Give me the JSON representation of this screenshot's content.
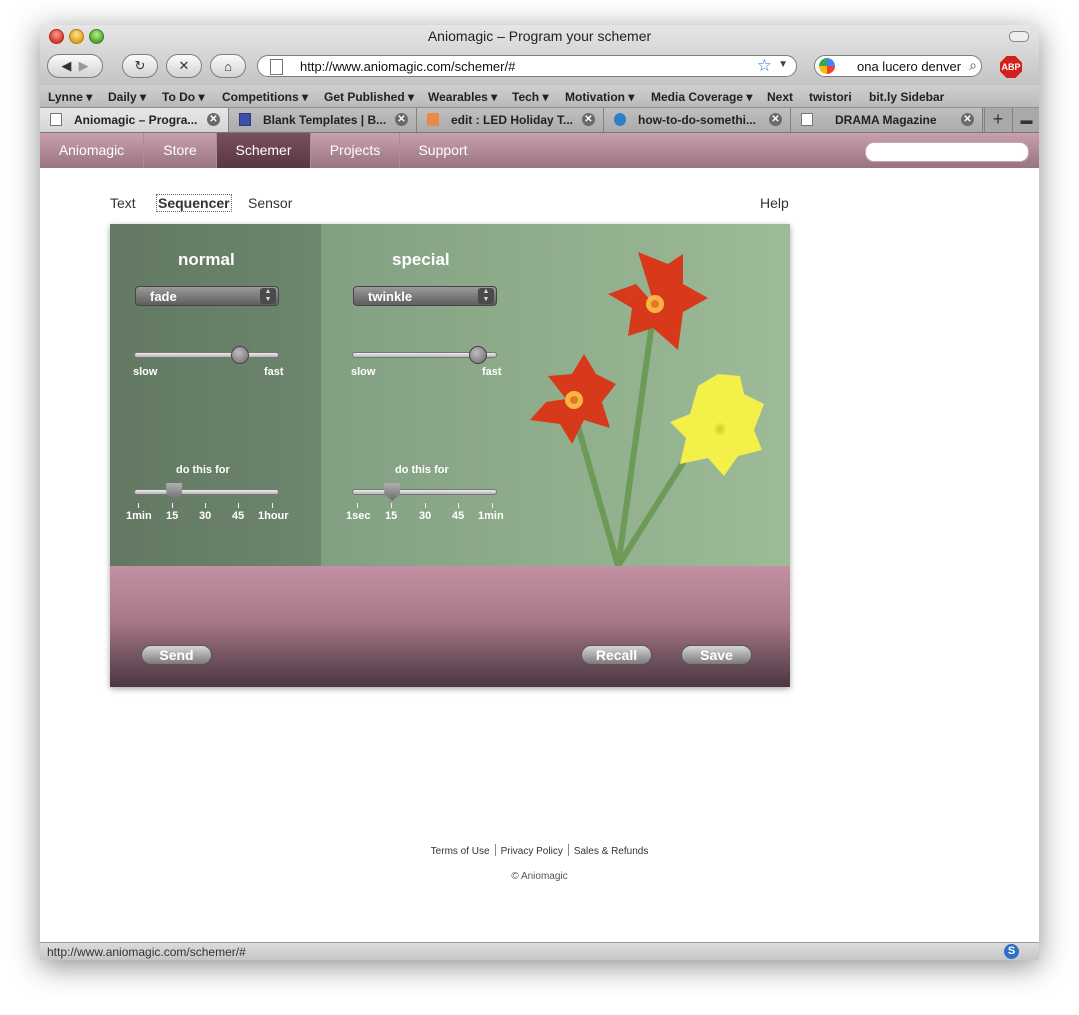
{
  "window": {
    "title": "Aniomagic – Program your schemer"
  },
  "toolbar": {
    "url": "http://www.aniomagic.com/schemer/#",
    "search_value": "ona lucero denver",
    "abp_label": "ABP"
  },
  "bookmarks": [
    {
      "label": "Lynne"
    },
    {
      "label": "Daily"
    },
    {
      "label": "To Do"
    },
    {
      "label": "Competitions"
    },
    {
      "label": "Get Published"
    },
    {
      "label": "Wearables"
    },
    {
      "label": "Tech"
    },
    {
      "label": "Motivation"
    },
    {
      "label": "Media Coverage"
    },
    {
      "label": "Next"
    },
    {
      "label": "twistori"
    },
    {
      "label": "bit.ly Sidebar"
    }
  ],
  "tabs": [
    {
      "label": "Aniomagic – Progra..."
    },
    {
      "label": "Blank Templates | B..."
    },
    {
      "label": "edit : LED Holiday T..."
    },
    {
      "label": "how-to-do-somethi..."
    },
    {
      "label": "DRAMA Magazine"
    }
  ],
  "site_nav": [
    {
      "label": "Aniomagic"
    },
    {
      "label": "Store"
    },
    {
      "label": "Schemer"
    },
    {
      "label": "Projects"
    },
    {
      "label": "Support"
    }
  ],
  "subtabs": {
    "text": "Text",
    "sequencer": "Sequencer",
    "sensor": "Sensor",
    "help": "Help"
  },
  "normal": {
    "title": "normal",
    "mode": "fade",
    "speed_min": "slow",
    "speed_max": "fast",
    "speed_level": 0.76,
    "duration_label": "do this for",
    "duration_level": 0.25,
    "ticks": [
      "1min",
      "15",
      "30",
      "45",
      "1hour"
    ]
  },
  "special": {
    "title": "special",
    "mode": "twinkle",
    "speed_min": "slow",
    "speed_max": "fast",
    "speed_level": 0.92,
    "duration_label": "do this for",
    "duration_level": 0.25,
    "ticks": [
      "1sec",
      "15",
      "30",
      "45",
      "1min"
    ]
  },
  "buttons": {
    "send": "Send",
    "recall": "Recall",
    "save": "Save"
  },
  "footer": {
    "terms": "Terms of Use",
    "privacy": "Privacy Policy",
    "sales": "Sales & Refunds",
    "copyright": "© Aniomagic"
  },
  "status": {
    "text": "http://www.aniomagic.com/schemer/#",
    "icon_letter": "S"
  },
  "colors": {
    "accent_nav": "#a87889",
    "normal_panel": "#677e67",
    "special_panel": "#93b08e",
    "flower_red": "#d8391a",
    "flower_yellow": "#f3f04a"
  }
}
